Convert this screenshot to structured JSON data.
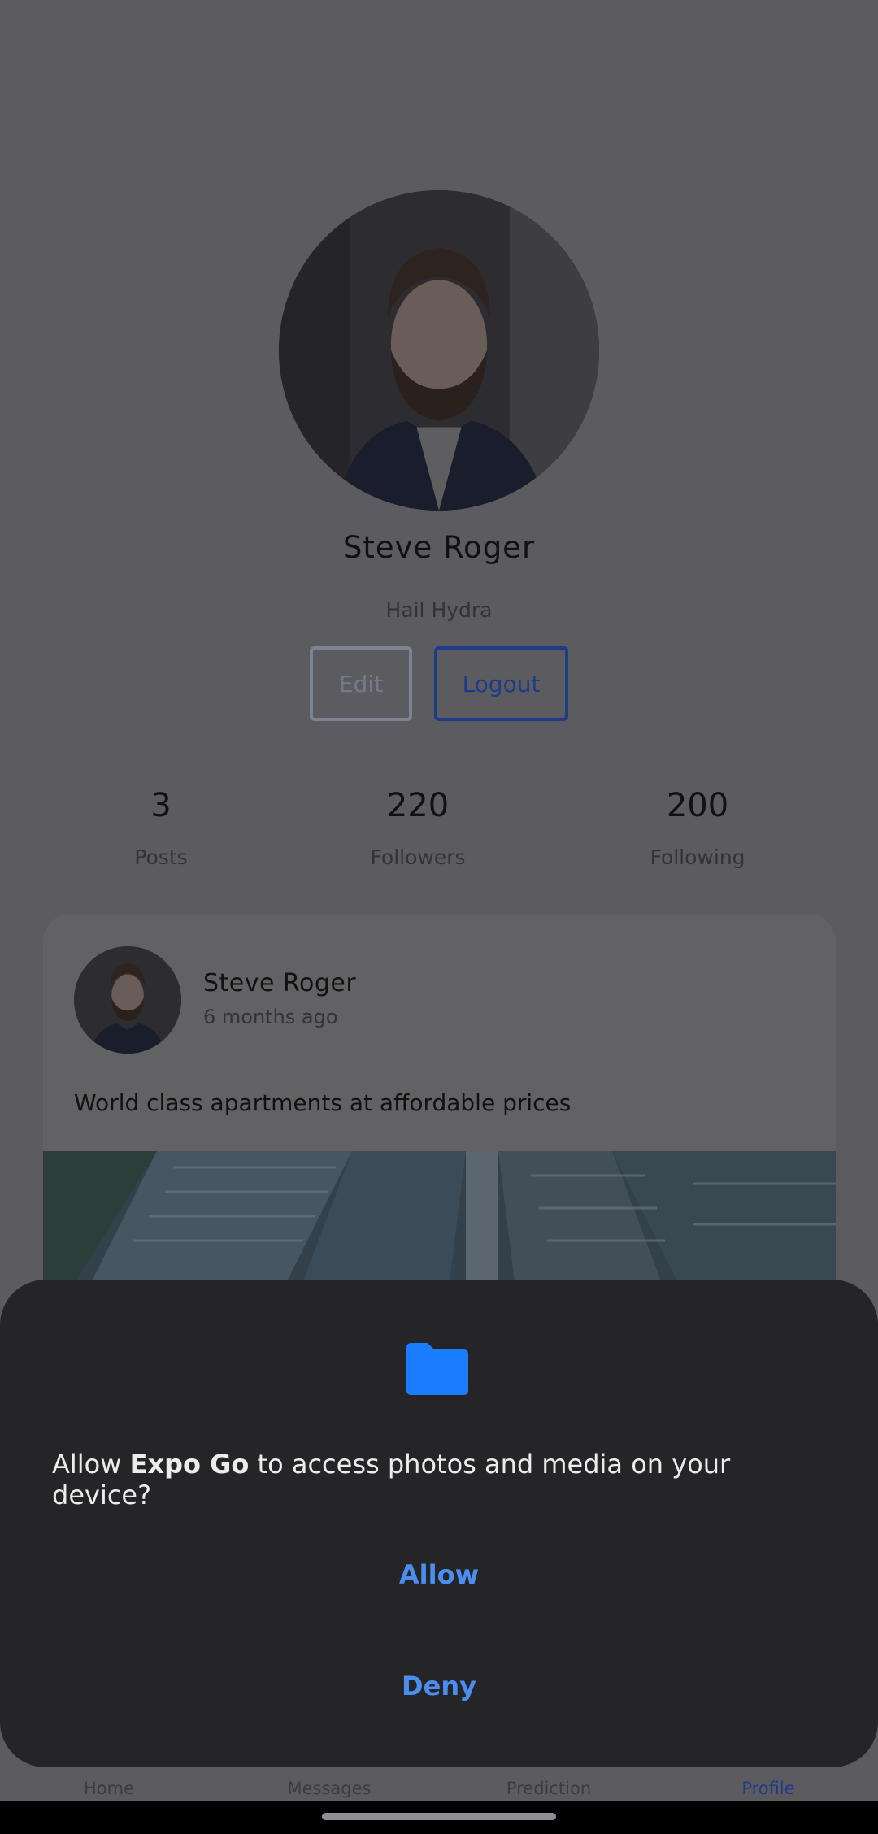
{
  "profile": {
    "name": "Steve Roger",
    "bio": "Hail Hydra",
    "edit_label": "Edit",
    "logout_label": "Logout"
  },
  "stats": [
    {
      "value": "3",
      "label": "Posts"
    },
    {
      "value": "220",
      "label": "Followers"
    },
    {
      "value": "200",
      "label": "Following"
    }
  ],
  "post": {
    "author": "Steve Roger",
    "time": "6 months ago",
    "text": "World class apartments at affordable prices"
  },
  "tabs": [
    {
      "label": "Home",
      "active": false
    },
    {
      "label": "Messages",
      "active": false
    },
    {
      "label": "Prediction",
      "active": false
    },
    {
      "label": "Profile",
      "active": true
    }
  ],
  "permission_dialog": {
    "icon": "folder-icon",
    "message_prefix": "Allow ",
    "app_name": "Expo Go",
    "message_suffix": " to access photos and media on your device?",
    "allow_label": "Allow",
    "deny_label": "Deny"
  },
  "colors": {
    "accent": "#1f3a86",
    "dialog_button": "#4b8ef2",
    "folder": "#1a7cff",
    "dialog_bg": "#252527"
  }
}
